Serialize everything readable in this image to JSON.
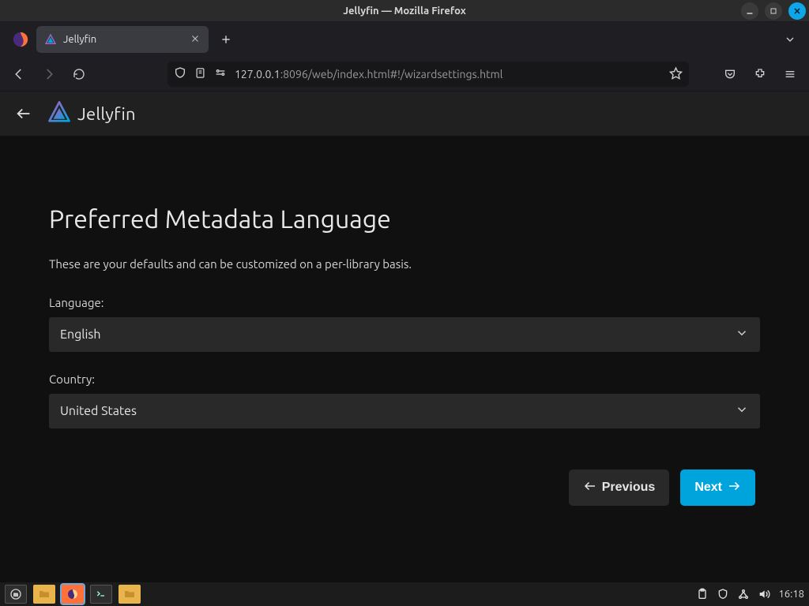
{
  "os": {
    "window_title": "Jellyfin — Mozilla Firefox",
    "clock": "16:18"
  },
  "browser": {
    "tab_title": "Jellyfin",
    "url_host": "127.0.0.1",
    "url_rest": ":8096/web/index.html#!/wizardsettings.html"
  },
  "jellyfin": {
    "brand": "Jellyfin",
    "heading": "Preferred Metadata Language",
    "description": "These are your defaults and can be customized on a per-library basis.",
    "language_label": "Language:",
    "language_value": "English",
    "country_label": "Country:",
    "country_value": "United States",
    "previous_label": "Previous",
    "next_label": "Next"
  }
}
